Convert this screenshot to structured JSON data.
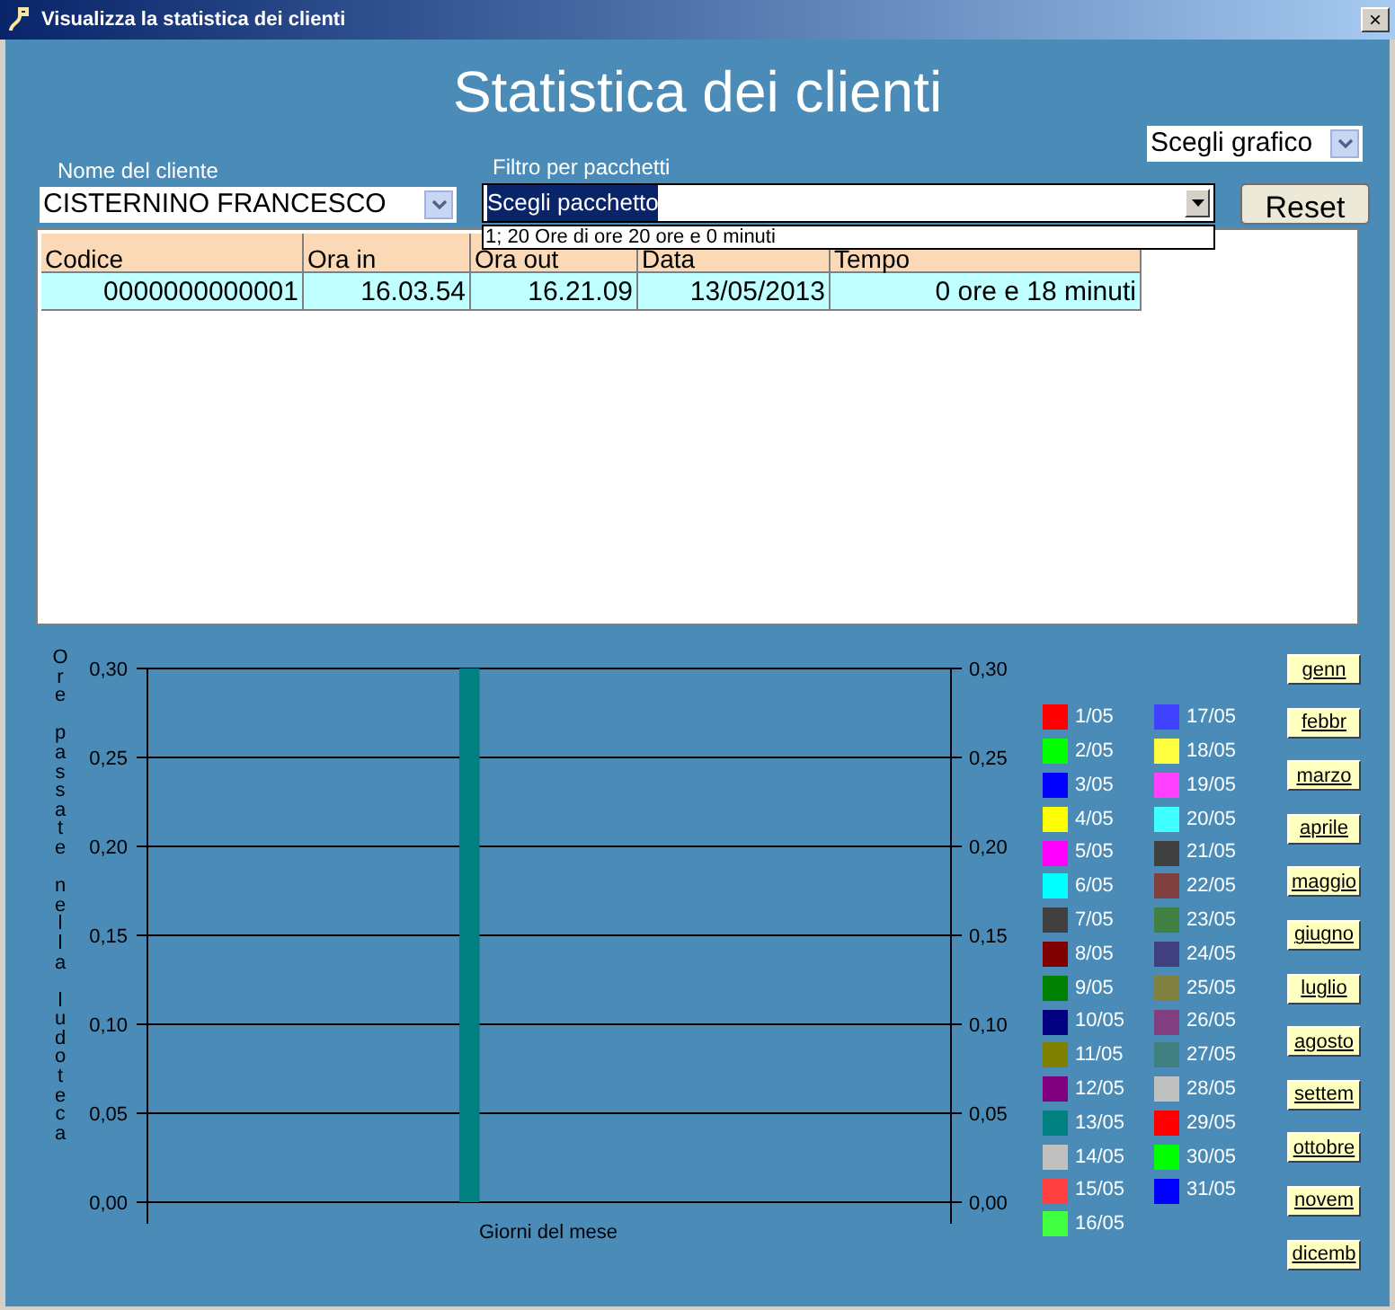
{
  "window": {
    "title": "Visualizza la statistica dei clienti",
    "close": "×"
  },
  "heading": "Statistica dei clienti",
  "chart_select": {
    "value": "Scegli grafico"
  },
  "client": {
    "label": "Nome del cliente",
    "value": "CISTERNINO FRANCESCO"
  },
  "package_filter": {
    "label": "Filtro per pacchetti",
    "value": "Scegli pacchetto",
    "expanded": true,
    "options": [
      "1; 20 Ore di ore 20 ore e 0 minuti"
    ]
  },
  "reset_button": "Reset",
  "table": {
    "columns": [
      "Codice",
      "Ora in",
      "Ora out",
      "Data",
      "Tempo"
    ],
    "rows": [
      [
        "0000000000001",
        "16.03.54",
        "16.21.09",
        "13/05/2013",
        "0 ore e 18 minuti"
      ]
    ]
  },
  "chart_data": {
    "type": "bar",
    "xlabel": "Giorni del mese",
    "ylabel": "Ore passate nella ludoteca",
    "grid": true,
    "series": [
      {
        "color": "#008080",
        "values": [
          null,
          null,
          null,
          null,
          null,
          null,
          null,
          null,
          null,
          null,
          null,
          null,
          0.3,
          null,
          null,
          null,
          null,
          null,
          null,
          null,
          null,
          null,
          null,
          null,
          null,
          null,
          null,
          null,
          null,
          null,
          null
        ]
      }
    ],
    "ylim": [
      0,
      0.3
    ],
    "yticks": [
      {
        "value": 0,
        "label": "0,00"
      },
      {
        "value": 0.05,
        "label": "0,05"
      },
      {
        "value": 0.1,
        "label": "0,10"
      },
      {
        "value": 0.15,
        "label": "0,15"
      },
      {
        "value": 0.2,
        "label": "0,20"
      },
      {
        "value": 0.25,
        "label": "0,25"
      },
      {
        "value": 0.3,
        "label": "0,30"
      }
    ]
  },
  "legend": [
    {
      "label": "1/05",
      "color": "#ff0000"
    },
    {
      "label": "2/05",
      "color": "#00ff00"
    },
    {
      "label": "3/05",
      "color": "#0000ff"
    },
    {
      "label": "4/05",
      "color": "#ffff00"
    },
    {
      "label": "5/05",
      "color": "#ff00ff"
    },
    {
      "label": "6/05",
      "color": "#00ffff"
    },
    {
      "label": "7/05",
      "color": "#404040"
    },
    {
      "label": "8/05",
      "color": "#800000"
    },
    {
      "label": "9/05",
      "color": "#008000"
    },
    {
      "label": "10/05",
      "color": "#000080"
    },
    {
      "label": "11/05",
      "color": "#808000"
    },
    {
      "label": "12/05",
      "color": "#800080"
    },
    {
      "label": "13/05",
      "color": "#008080"
    },
    {
      "label": "14/05",
      "color": "#c0c0c0"
    },
    {
      "label": "15/05",
      "color": "#ff4040"
    },
    {
      "label": "16/05",
      "color": "#40ff40"
    },
    {
      "label": "17/05",
      "color": "#4040ff"
    },
    {
      "label": "18/05",
      "color": "#ffff40"
    },
    {
      "label": "19/05",
      "color": "#ff40ff"
    },
    {
      "label": "20/05",
      "color": "#40ffff"
    },
    {
      "label": "21/05",
      "color": "#404040"
    },
    {
      "label": "22/05",
      "color": "#804040"
    },
    {
      "label": "23/05",
      "color": "#408040"
    },
    {
      "label": "24/05",
      "color": "#404080"
    },
    {
      "label": "25/05",
      "color": "#808040"
    },
    {
      "label": "26/05",
      "color": "#804080"
    },
    {
      "label": "27/05",
      "color": "#408080"
    },
    {
      "label": "28/05",
      "color": "#c0c0c0"
    },
    {
      "label": "29/05",
      "color": "#ff0000"
    },
    {
      "label": "30/05",
      "color": "#00ff00"
    },
    {
      "label": "31/05",
      "color": "#0000ff"
    }
  ],
  "months": [
    "genn",
    "febbr",
    "marzo",
    "aprile",
    "maggio",
    "giugno",
    "luglio",
    "agosto",
    "settem",
    "ottobre",
    "novem",
    "dicemb"
  ]
}
